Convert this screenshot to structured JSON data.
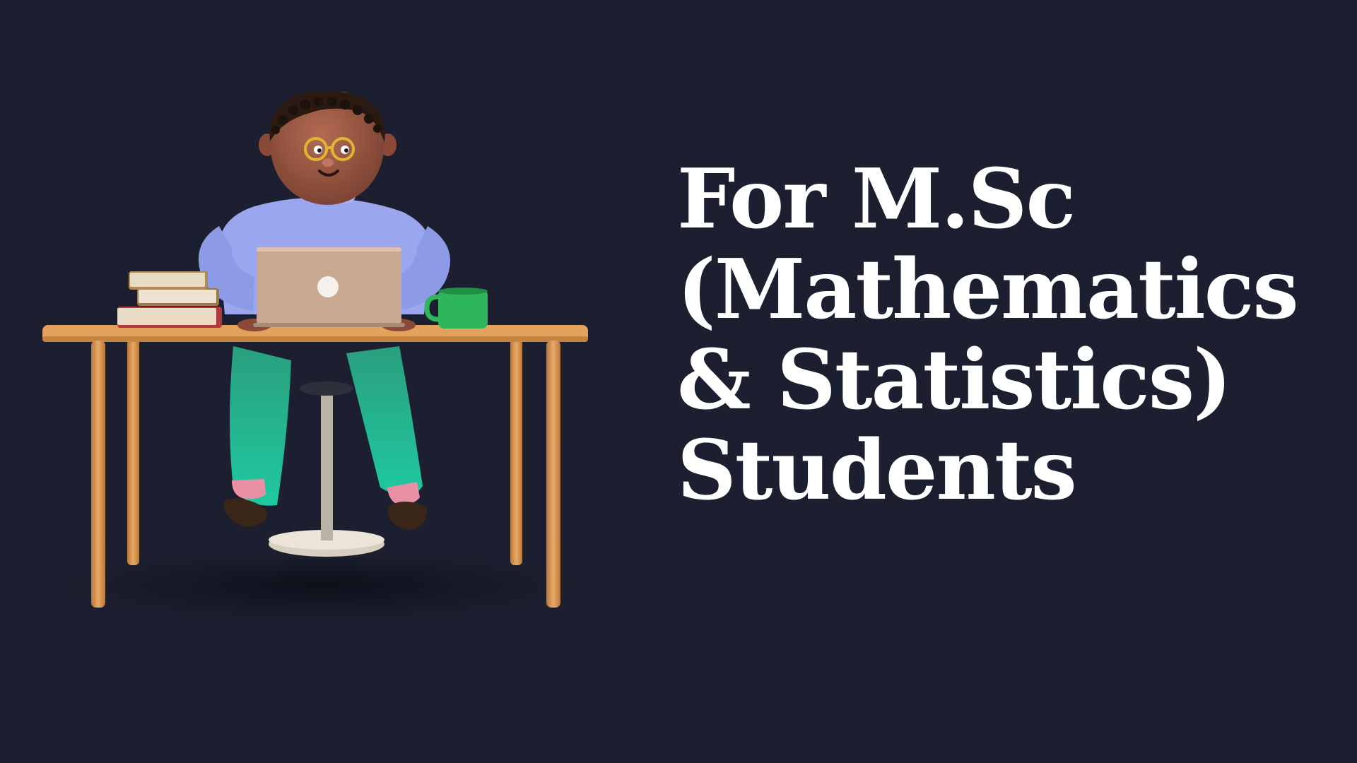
{
  "headline": {
    "lines": [
      "For M.Sc",
      "(Mathematics",
      "& Statistics)",
      "Students"
    ]
  },
  "illustration": {
    "subject": "student-at-desk-with-laptop",
    "colors": {
      "background": "#1c1f2f",
      "sweater": "#9aa6ee",
      "pants": "#27b58c",
      "desk": "#e3a25c",
      "laptop": "#c9a892",
      "mug": "#2fb55a",
      "skin": "#9a5a45"
    }
  }
}
